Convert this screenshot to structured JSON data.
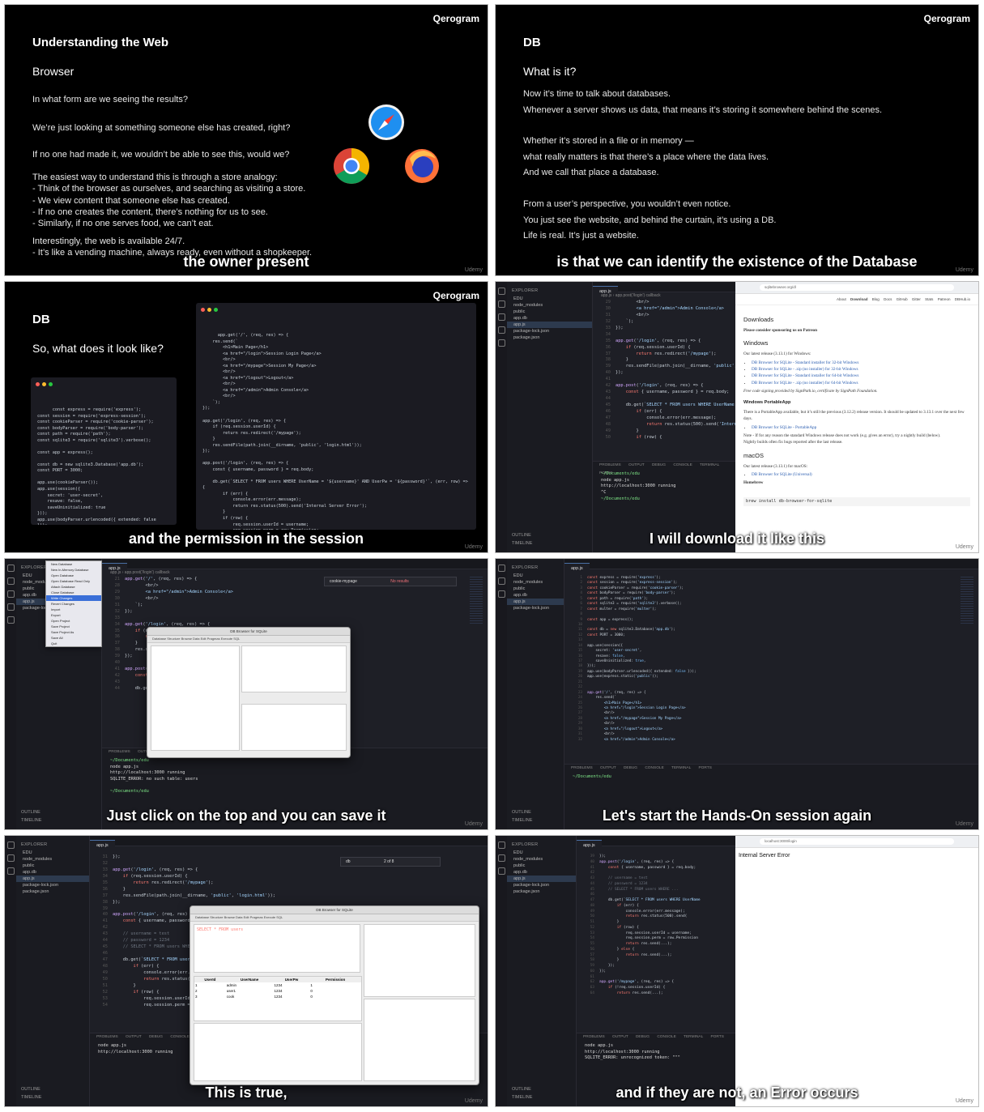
{
  "brand": "Qerogram",
  "watermark": "Udemy",
  "frames": {
    "f1": {
      "title": "Understanding the Web",
      "subtitle": "Browser",
      "lines": [
        "In what form are we seeing the results?",
        "We’re just looking at something someone else has created, right?",
        "If no one had made it, we wouldn’t be able to see this, would we?"
      ],
      "analogy": [
        "The easiest way to understand this is through a store analogy:",
        "- Think of the browser as ourselves, and searching as visiting a store.",
        "- We view content that someone else has created.",
        "- If no one creates the content, there’s nothing for us to see.",
        "- Similarly, if no one serves food, we can’t eat."
      ],
      "tail": [
        "Interestingly, the web is available 24/7.",
        "- It’s like a vending machine, always ready, even without a shopkeeper."
      ],
      "caption": "the owner present",
      "icons": [
        "safari-icon",
        "chrome-icon",
        "firefox-icon"
      ]
    },
    "f2": {
      "title": "DB",
      "subtitle": "What is it?",
      "lines": [
        "Now it’s time to talk about databases.",
        "Whenever a server shows us data, that means it’s storing it somewhere behind the scenes.",
        "",
        "Whether it’s stored in a file or in memory —",
        "what really matters is that there’s a place where the data lives.",
        "And we call that place a database.",
        "",
        "From a user’s perspective, you wouldn’t even notice.",
        "You just see the website, and behind the curtain, it’s using a DB.",
        "Life is real. It’s just a website."
      ],
      "caption": "is that we can identify the existence of the Database"
    },
    "f3": {
      "title": "DB",
      "subtitle": "So, what does it look like?",
      "caption": "and the permission in the session",
      "code_left": "const express = require('express');\nconst session = require('express-session');\nconst cookieParser = require('cookie-parser');\nconst bodyParser = require('body-parser');\nconst path = require('path');\nconst sqlite3 = require('sqlite3').verbose();\n\nconst app = express();\n\nconst db = new sqlite3.Database('app.db');\nconst PORT = 3000;\n\napp.use(cookieParser());\napp.use(session({\n    secret: 'user-secret',\n    resave: false,\n    saveUninitialized: true\n}));\napp.use(bodyParser.urlencoded({ extended: false\n}));\napp.use(express.static('public'));",
      "code_right": "app.get('/', (req, res) => {\n    res.send(`\n        <h1>Main Page</h1>\n        <a href=\"/login\">Session Login Page</a>\n        <br/>\n        <a href=\"/mypage\">Session My Page</a>\n        <br/>\n        <a href=\"/logout\">Logout</a>\n        <br/>\n        <a href=\"/admin\">Admin Console</a>\n        <br/>\n    `);\n});\n\napp.get('/login', (req, res) => {\n    if (req.session.userId) {\n        return res.redirect('/mypage');\n    }\n    res.sendFile(path.join(__dirname, 'public', 'login.html'));\n});\n\napp.post('/login', (req, res) => {\n    const { username, password } = req.body;\n\n    db.get(`SELECT * FROM users WHERE UserName = '${username}' AND UserPw = '${password}'`, (err, row) =>\n{\n        if (err) {\n            console.error(err.message);\n            return res.status(500).send('Internal Server Error');\n        }\n        if (row) {\n            req.session.userId = username;\n            req.session.perm = row.Permission;\n            return res.send(`<h3>Login Successful</h3><a href=\"/mypage\">Go to My Page</a>`);\n        } else {\n            return res.send(`<h3>Login Failed</h3><a href=\"/login\">Try Again</a>`);\n        }"
    },
    "f4": {
      "caption": "I will download it like this",
      "explorer": {
        "header": "EXPLORER",
        "folder": "EDU",
        "items": [
          "node_modules",
          "public",
          "app.db",
          "app.js",
          "package-lock.json",
          "package.json"
        ],
        "bottom": [
          "OUTLINE",
          "TIMELINE"
        ]
      },
      "tab": "app.js",
      "terminal": [
        "node app.js",
        "http://localhost:3000 running"
      ],
      "panel_tabs": "PROBLEMS OUTPUT DEBUG CONSOLE TERMINAL PORTS",
      "web": {
        "nav": [
          "About",
          "Download",
          "Blog",
          "Docs",
          "GitHub",
          "Gitter",
          "Stats",
          "Patreon",
          "DBHub.io"
        ],
        "heading": "Downloads",
        "sponsor": "Please consider sponsoring us on Patreon",
        "windows_title": "Windows",
        "windows_intro": "Our latest release (3.13.1) for Windows:",
        "windows_links": [
          "DB Browser for SQLite - Standard installer for 32-bit Windows",
          "DB Browser for SQLite - .zip (no installer) for 32-bit Windows",
          "DB Browser for SQLite - Standard installer for 64-bit Windows",
          "DB Browser for SQLite - .zip (no installer) for 64-bit Windows"
        ],
        "signing": "Free code signing provided by SignPath.io, certificate by SignPath Foundation.",
        "portable_title": "Windows PortableApp",
        "portable_text": "There is a PortableApp available, but it’s still the previous (3.12.2) release version. It should be updated to 3.13.1 over the next few days.",
        "portable_link": "DB Browser for SQLite - PortableApp",
        "note": "Note - If for any reason the standard Windows release does not work (e.g. gives an error), try a nightly build (below).",
        "nightly": "Nightly builds often fix bugs reported after the last release.",
        "mac_title": "macOS",
        "mac_intro": "Our latest release (3.13.1) for macOS:",
        "mac_link": "DB Browser for SQLite (Universal)",
        "brew_title": "Homebrew",
        "brew_cmd": "brew install db-browser-for-sqlite"
      }
    },
    "f5": {
      "caption": "Just click on the top and you can save it",
      "search": "cookie-mypage",
      "no_results": "No results",
      "terminal": [
        "node app.js",
        "http://localhost:3000 running",
        "SQLITE_ERROR: no such table: users"
      ],
      "dialog_title": "DB Browser for SQLite",
      "dialog_tabs": "Database Structure  Browse Data  Edit Pragmas  Execute SQL",
      "menu": [
        "New Database",
        "New In-Memory Database",
        "Open Database",
        "Open Database Read Only",
        "Attach Database",
        "Close Database",
        "Write Changes",
        "Revert Changes",
        "Import",
        "Export",
        "Open Project",
        "Save Project",
        "Save Project As",
        "Save All",
        "Quit"
      ]
    },
    "f6": {
      "caption": "Let's start the Hands-On session again"
    },
    "f7": {
      "caption": "This is true,",
      "search": "db",
      "match": "2 of 8",
      "query": "SELECT * FROM users",
      "table_headers": [
        "UserId",
        "UserName",
        "UserPw",
        "Permission"
      ],
      "table_rows": [
        [
          "1",
          "admin",
          "1234",
          "1"
        ],
        [
          "2",
          "user1",
          "1234",
          "0"
        ],
        [
          "3",
          "cook",
          "1234",
          "0"
        ]
      ]
    },
    "f8": {
      "caption": "and if they are not, an Error occurs",
      "error_text": "Internal Server Error",
      "url": "localhost:3000/login",
      "terminal": [
        "node app.js",
        "http://localhost:3000 running",
        "SQLITE_ERROR: unrecognized token: \"\"\""
      ]
    }
  }
}
